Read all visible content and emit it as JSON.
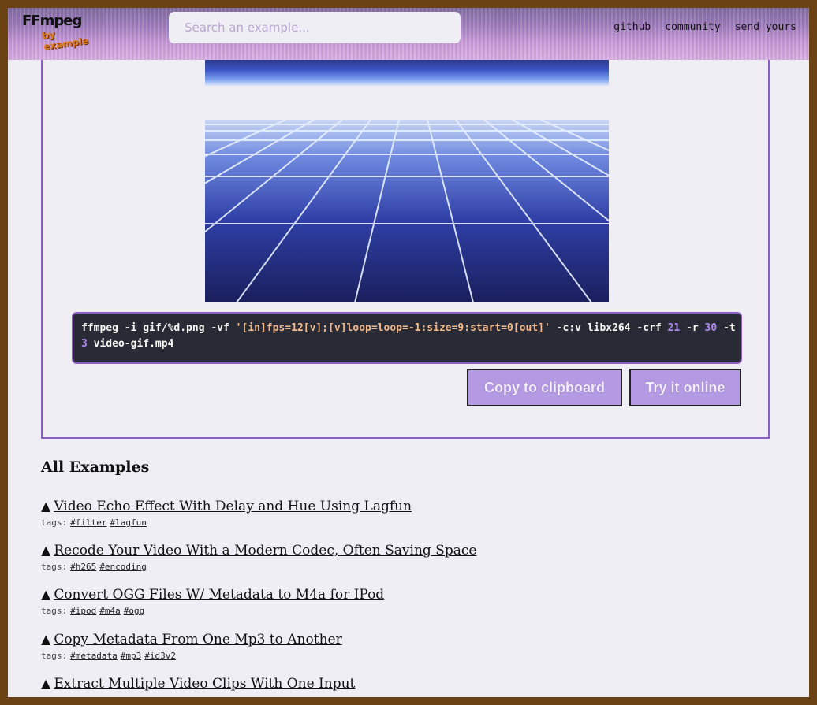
{
  "header": {
    "logo_text": "FFmpeg",
    "logo_sub": "by example",
    "search_placeholder": "Search an example...",
    "nav": [
      "github",
      "community",
      "send yours"
    ]
  },
  "example": {
    "command_parts": [
      {
        "t": "ffmpeg -i gif/%d.png -vf ",
        "c": ""
      },
      {
        "t": "'[in]fps=12[v];[v]loop=loop=-1:size=9:start=0[out]'",
        "c": "str"
      },
      {
        "t": " -c:v libx264 -crf ",
        "c": ""
      },
      {
        "t": "21",
        "c": "num"
      },
      {
        "t": " -r ",
        "c": ""
      },
      {
        "t": "30",
        "c": "num"
      },
      {
        "t": " -t\n",
        "c": ""
      },
      {
        "t": "3",
        "c": "num"
      },
      {
        "t": " video-gif.mp4",
        "c": ""
      }
    ],
    "copy_label": "Copy to clipboard",
    "try_label": "Try it online"
  },
  "all_examples": {
    "title": "All Examples",
    "tags_label": "tags:",
    "items": [
      {
        "title": "Video Echo Effect With Delay and Hue Using Lagfun",
        "tags": [
          "#filter",
          "#lagfun"
        ]
      },
      {
        "title": "Recode Your Video With a Modern Codec, Often Saving Space",
        "tags": [
          "#h265",
          "#encoding"
        ]
      },
      {
        "title": "Convert OGG Files W/ Metadata to M4a for IPod",
        "tags": [
          "#ipod",
          "#m4a",
          "#ogg"
        ]
      },
      {
        "title": "Copy Metadata From One Mp3 to Another",
        "tags": [
          "#metadata",
          "#mp3",
          "#id3v2"
        ]
      },
      {
        "title": "Extract Multiple Video Clips With One Input",
        "tags": []
      }
    ]
  },
  "colors": {
    "accent": "#8c5ec2",
    "button": "#b49ae2",
    "code_bg": "#282a36",
    "frame": "#6b4214"
  }
}
